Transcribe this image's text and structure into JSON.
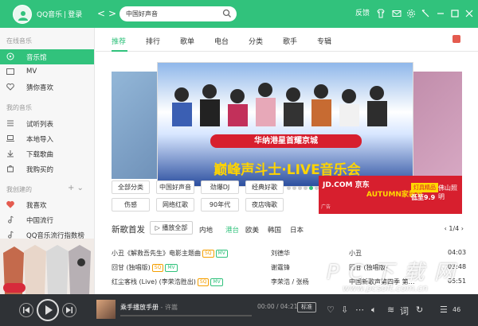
{
  "titlebar": {
    "app_name": "QQ音乐",
    "separator": "|",
    "login_label": "登录",
    "back_glyph": "<",
    "forward_glyph": ">",
    "search_value": "中国好声音",
    "feedback_label": "反馈",
    "accent_color": "#31c27c"
  },
  "sidebar": {
    "section_online": "在线音乐",
    "section_mine": "我的音乐",
    "section_created": "我创建的",
    "add_glyph": "+ ⌄",
    "items": [
      {
        "label": "音乐馆",
        "icon": "music-hall-icon"
      },
      {
        "label": "MV",
        "icon": "mv-icon"
      },
      {
        "label": "猜你喜欢",
        "icon": "heart-icon"
      },
      {
        "label": "试听列表",
        "icon": "list-icon"
      },
      {
        "label": "本地导入",
        "icon": "laptop-icon"
      },
      {
        "label": "下载歌曲",
        "icon": "download-icon"
      },
      {
        "label": "我购买的",
        "icon": "bag-icon"
      },
      {
        "label": "我喜欢",
        "icon": "heart-icon"
      },
      {
        "label": "中国流行",
        "icon": "music-note-icon"
      },
      {
        "label": "QQ音乐流行指数榜",
        "icon": "music-note-icon"
      }
    ]
  },
  "tabs": [
    "推荐",
    "排行",
    "歌单",
    "电台",
    "分类",
    "歌手",
    "专辑"
  ],
  "banner": {
    "subtitle": "华纳港星首耀京城",
    "title": "巅峰声斗士·LIVE音乐会"
  },
  "carousel_dots": 7,
  "chips_row1": [
    "全部分类",
    "中国好声音",
    "劲爆DJ",
    "经典好歌"
  ],
  "chips_row2": [
    "伤感",
    "网络红歌",
    "90年代",
    "夜店嗨歌"
  ],
  "ad": {
    "logo": "JD.COM 京东",
    "line1": "AUTUMN家装节",
    "line2": "灯具精品",
    "line3": "低至9.9",
    "brand": "佛山照明",
    "tag": "广告"
  },
  "new_songs": {
    "title": "新歌首发",
    "play_all": "播放全部",
    "regions": [
      "内地",
      "港台",
      "欧美",
      "韩国",
      "日本"
    ],
    "active_region": "港台",
    "pager": "1/4",
    "songs": [
      {
        "name": "小丑《解救吾先生》电影主题曲",
        "artist": "刘德华",
        "album": "小丑",
        "duration": "04:03",
        "tags": [
          "SQ",
          "MV"
        ]
      },
      {
        "name": "回甘 (独唱版)",
        "artist": "谢霆锋",
        "album": "回甘 (独唱版)",
        "duration": "03:48",
        "tags": [
          "SQ",
          "MV"
        ]
      },
      {
        "name": "红尘客栈 (Live) (李荣浩胜出)",
        "artist": "李荣浩 / 张杨",
        "album": "中国新歌声第四季 第…",
        "duration": "05:51",
        "tags": [
          "SQ",
          "MV"
        ]
      }
    ]
  },
  "player": {
    "track": "乘手播放手册",
    "separator": " - ",
    "artist": "许嵩",
    "time": "00:00 / 04:21",
    "quality": "标准",
    "lyric_icon": "词",
    "count": "46"
  },
  "watermark": {
    "line1": "P C 下 载 网",
    "line2": "www.pcsoft.com.cn"
  }
}
